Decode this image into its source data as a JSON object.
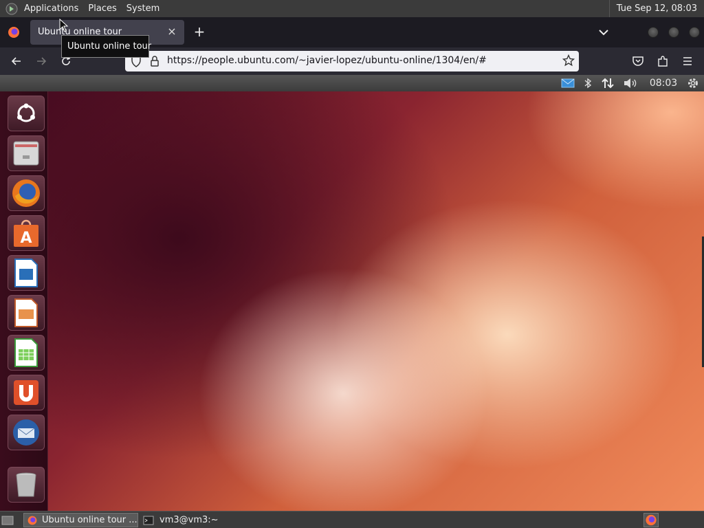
{
  "top_panel": {
    "menus": [
      "Applications",
      "Places",
      "System"
    ],
    "clock": "Tue Sep 12, 08:03"
  },
  "browser": {
    "tab": {
      "title": "Ubuntu online tour",
      "close": "×"
    },
    "new_tab": "+",
    "tooltip": "Ubuntu online tour",
    "url": "https://people.ubuntu.com/~javier-lopez/ubuntu-online/1304/en/#"
  },
  "ubuntu_tour": {
    "panel_time": "08:03",
    "launcher_items": [
      "ubuntu-dash-icon",
      "files-icon",
      "firefox-icon",
      "software-center-icon",
      "libreoffice-writer-icon",
      "libreoffice-impress-icon",
      "libreoffice-calc-icon",
      "ubuntu-one-icon",
      "thunderbird-icon",
      "trash-icon"
    ]
  },
  "taskbar": {
    "tasks": [
      "Ubuntu online tour ...",
      "vm3@vm3:~"
    ]
  },
  "colors": {
    "panel": "#3b3b3b",
    "tabbar": "#1c1b22",
    "navbar": "#2b2a33",
    "accent": "#e95420"
  }
}
